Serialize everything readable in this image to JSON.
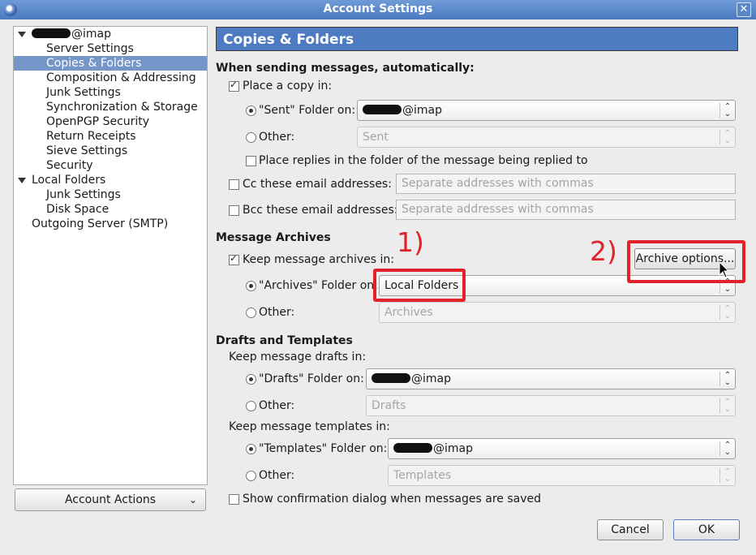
{
  "window": {
    "title": "Account Settings"
  },
  "tree": {
    "account": "@imap",
    "items": [
      "Server Settings",
      "Copies & Folders",
      "Composition & Addressing",
      "Junk Settings",
      "Synchronization & Storage",
      "OpenPGP Security",
      "Return Receipts",
      "Sieve Settings",
      "Security"
    ],
    "local_folders": "Local Folders",
    "local_items": [
      "Junk Settings",
      "Disk Space"
    ],
    "outgoing": "Outgoing Server (SMTP)"
  },
  "account_actions": "Account Actions",
  "panel": {
    "title": "Copies & Folders",
    "sending": {
      "heading": "When sending messages, automatically:",
      "place_copy": "Place a copy in:",
      "sent_folder_label": "\"Sent\" Folder on:",
      "sent_folder_value": "@imap",
      "other_label": "Other:",
      "other_value": "Sent",
      "replies": "Place replies in the folder of the message being replied to",
      "cc_label": "Cc these email addresses:",
      "cc_placeholder": "Separate addresses with commas",
      "bcc_label": "Bcc these email addresses:",
      "bcc_placeholder": "Separate addresses with commas"
    },
    "archives": {
      "heading": "Message Archives",
      "keep": "Keep message archives in:",
      "options_button": "Archive options...",
      "folder_label": "\"Archives\" Folder on:",
      "folder_value": "Local Folders",
      "other_label": "Other:",
      "other_value": "Archives"
    },
    "drafts": {
      "heading": "Drafts and Templates",
      "keep_drafts": "Keep message drafts in:",
      "drafts_label": "\"Drafts\" Folder on:",
      "drafts_value": "@imap",
      "other_label": "Other:",
      "drafts_other": "Drafts",
      "keep_templates": "Keep message templates in:",
      "templates_label": "\"Templates\" Folder on:",
      "templates_value": "@imap",
      "templates_other": "Templates",
      "confirm": "Show confirmation dialog when messages are saved"
    }
  },
  "annotations": {
    "one": "1)",
    "two": "2)",
    "color": "#e3212b"
  },
  "buttons": {
    "cancel": "Cancel",
    "ok": "OK"
  }
}
